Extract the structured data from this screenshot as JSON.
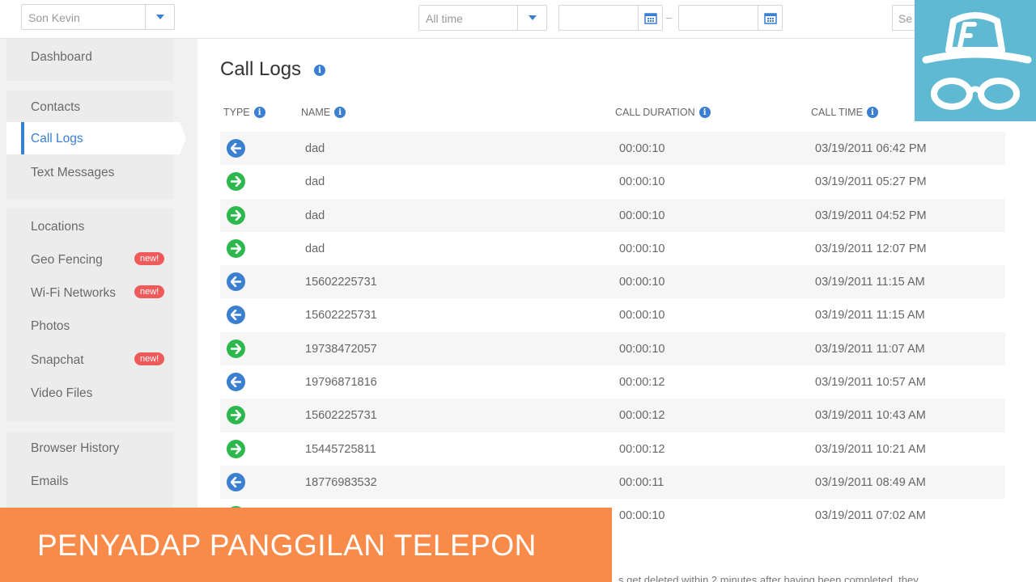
{
  "topbar": {
    "device_select": "Son Kevin",
    "time_select": "All time",
    "date_separator": "–",
    "search_placeholder": "Se"
  },
  "sidebar": {
    "groups": [
      [
        {
          "label": "Dashboard"
        }
      ],
      [
        {
          "label": "Contacts"
        },
        {
          "label": "Call Logs",
          "active": true
        },
        {
          "label": "Text Messages"
        }
      ],
      [
        {
          "label": "Locations"
        },
        {
          "label": "Geo Fencing",
          "badge": "new!"
        },
        {
          "label": "Wi-Fi Networks",
          "badge": "new!"
        },
        {
          "label": "Photos"
        },
        {
          "label": "Snapchat",
          "badge": "new!"
        },
        {
          "label": "Video Files"
        }
      ],
      [
        {
          "label": "Browser History"
        },
        {
          "label": "Emails"
        }
      ]
    ]
  },
  "main": {
    "title": "Call Logs",
    "columns": {
      "type": "TYPE",
      "name": "NAME",
      "duration": "CALL DURATION",
      "time": "CALL TIME"
    },
    "rows": [
      {
        "type": "incoming",
        "name": "dad",
        "duration": "00:00:10",
        "time": "03/19/2011 06:42 PM"
      },
      {
        "type": "outgoing",
        "name": "dad",
        "duration": "00:00:10",
        "time": "03/19/2011 05:27 PM"
      },
      {
        "type": "outgoing",
        "name": "dad",
        "duration": "00:00:10",
        "time": "03/19/2011 04:52 PM"
      },
      {
        "type": "outgoing",
        "name": "dad",
        "duration": "00:00:10",
        "time": "03/19/2011 12:07 PM"
      },
      {
        "type": "incoming",
        "name": "15602225731",
        "duration": "00:00:10",
        "time": "03/19/2011 11:15 AM"
      },
      {
        "type": "incoming",
        "name": "15602225731",
        "duration": "00:00:10",
        "time": "03/19/2011 11:15 AM"
      },
      {
        "type": "outgoing",
        "name": "19738472057",
        "duration": "00:00:10",
        "time": "03/19/2011 11:07 AM"
      },
      {
        "type": "incoming",
        "name": "19796871816",
        "duration": "00:00:12",
        "time": "03/19/2011 10:57 AM"
      },
      {
        "type": "outgoing",
        "name": "15602225731",
        "duration": "00:00:12",
        "time": "03/19/2011 10:43 AM"
      },
      {
        "type": "outgoing",
        "name": "15445725811",
        "duration": "00:00:12",
        "time": "03/19/2011 10:21 AM"
      },
      {
        "type": "incoming",
        "name": "18776983532",
        "duration": "00:00:11",
        "time": "03/19/2011 08:49 AM"
      },
      {
        "type": "outgoing",
        "name": "",
        "duration": "00:00:10",
        "time": "03/19/2011 07:02 AM"
      }
    ],
    "footnote": "s get deleted within 2 minutes after having been completed, they"
  },
  "overlay": {
    "banner_text": "PENYADAP PANGGILAN TELEPON",
    "logo_icon": "spy-hat-glasses-icon"
  },
  "colors": {
    "accent": "#3a7fd0",
    "outgoing": "#2db84d",
    "badge": "#f05a5a",
    "banner": "#f98b4a",
    "logo_bg": "#5fb9d3"
  }
}
